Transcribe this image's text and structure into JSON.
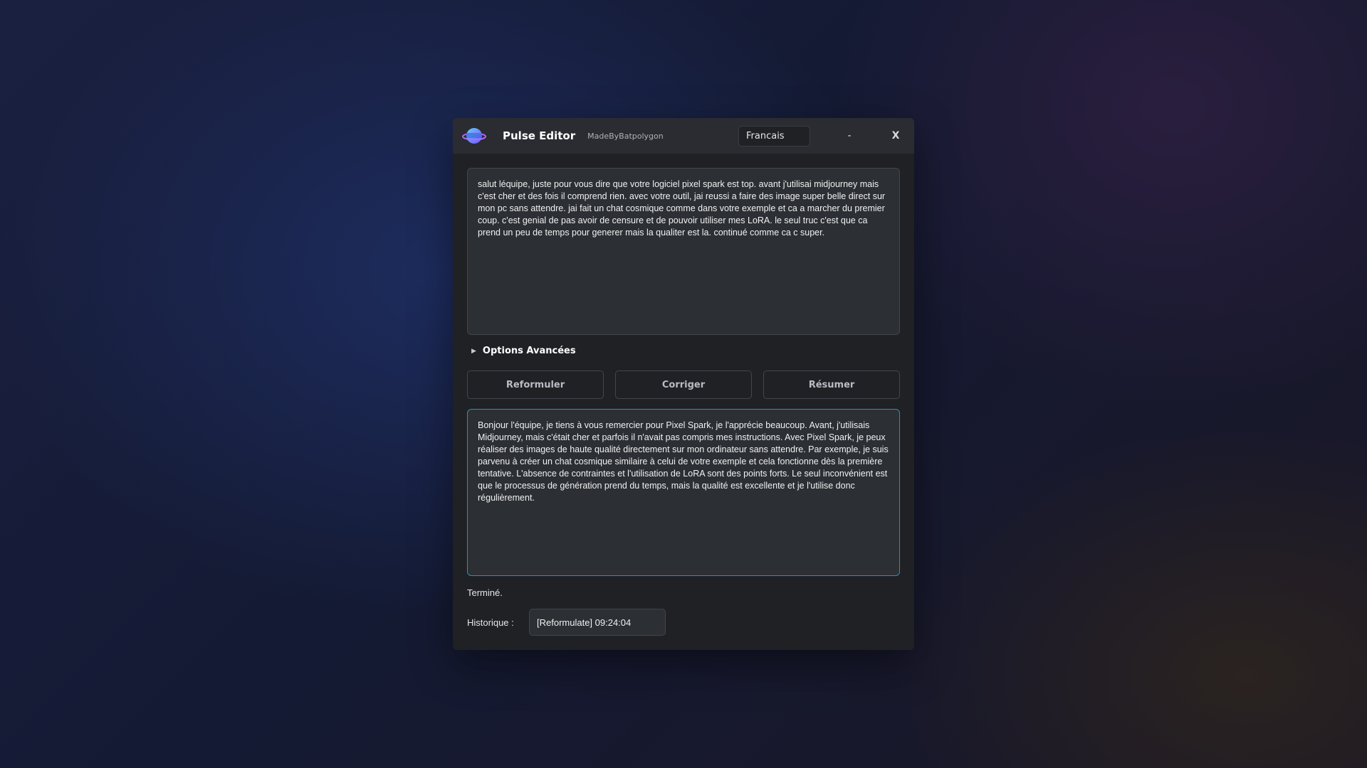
{
  "titlebar": {
    "logo_icon": "planet-logo-icon",
    "title": "Pulse Editor",
    "subtitle": "MadeByBatpolygon",
    "language": "Francais",
    "minimize_label": "-",
    "close_label": "X"
  },
  "input": {
    "text": "salut léquipe, juste pour vous dire que votre logiciel pixel spark est top. avant j'utilisai midjourney mais c'est cher et des fois il comprend rien. avec votre outil, jai reussi a faire des image super belle direct sur mon pc sans attendre. jai fait un chat cosmique comme dans votre exemple et ca a marcher du premier coup. c'est genial de pas avoir de censure et de pouvoir utiliser mes LoRA. le seul truc c'est que ca prend un peu de temps pour generer mais la qualiter est la. continué comme ca c super."
  },
  "advanced": {
    "label": "Options Avancées",
    "icon": "chevron-right-icon"
  },
  "actions": {
    "reformulate": "Reformuler",
    "correct": "Corriger",
    "summarize": "Résumer"
  },
  "output": {
    "text": "Bonjour l'équipe, je tiens à vous remercier pour Pixel Spark, je l'apprécie beaucoup. Avant, j'utilisais Midjourney, mais c'était cher et parfois il n'avait pas compris mes instructions. Avec Pixel Spark, je peux réaliser des images de haute qualité directement sur mon ordinateur sans attendre. Par exemple, je suis parvenu à créer un chat cosmique similaire à celui de votre exemple et cela fonctionne dès la première tentative. L'absence de contraintes et l'utilisation de LoRA sont des points forts. Le seul inconvénient est que le processus de génération prend du temps, mais la qualité est excellente et je l'utilise donc régulièrement."
  },
  "status": "Terminé.",
  "history": {
    "label": "Historique :",
    "selected": "[Reformulate] 09:24:04"
  },
  "colors": {
    "accent": "#2f8fb8",
    "window_bg": "#1f2125",
    "titlebar_bg": "#2a2c31",
    "field_bg": "#2c2f34"
  }
}
